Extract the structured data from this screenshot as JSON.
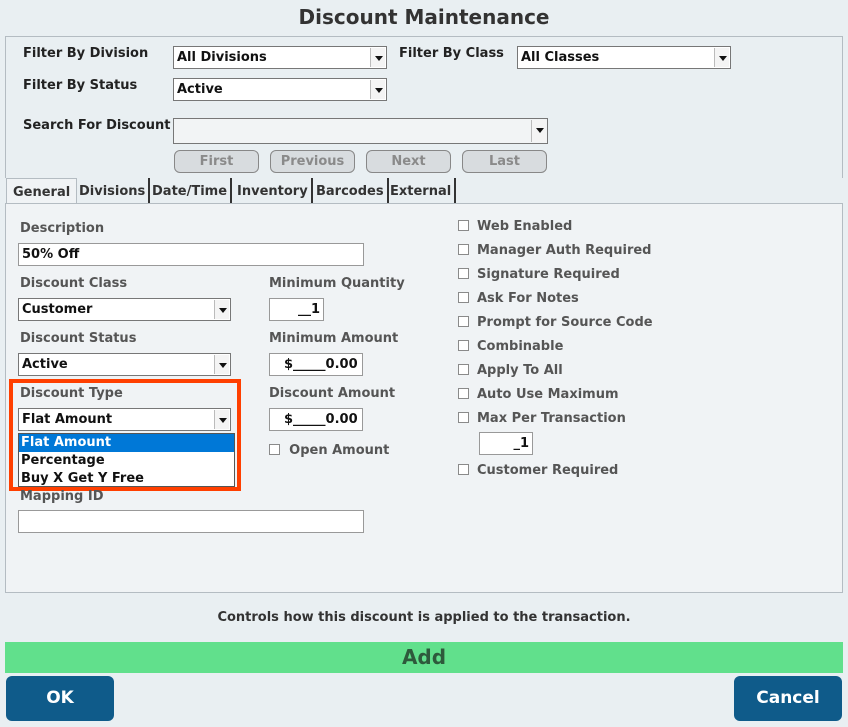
{
  "window": {
    "title": "Discount Maintenance"
  },
  "filters": {
    "division_label": "Filter By Division",
    "division_value": "All Divisions",
    "class_label": "Filter By Class",
    "class_value": "All Classes",
    "status_label": "Filter By Status",
    "status_value": "Active",
    "search_label": "Search For Discount",
    "search_value": ""
  },
  "nav": {
    "first": "First",
    "previous": "Previous",
    "next": "Next",
    "last": "Last"
  },
  "tabs": [
    {
      "label": "General"
    },
    {
      "label": "Divisions"
    },
    {
      "label": "Date/Time"
    },
    {
      "label": "Inventory"
    },
    {
      "label": "Barcodes"
    },
    {
      "label": "External"
    }
  ],
  "general": {
    "description_label": "Description",
    "description_value": "50% Off",
    "class_label": "Discount Class",
    "class_value": "Customer",
    "status_label": "Discount Status",
    "status_value": "Active",
    "type_label": "Discount Type",
    "type_value": "Flat Amount",
    "type_options": [
      "Flat Amount",
      "Percentage",
      "Buy X Get Y Free"
    ],
    "mapping_label": "Mapping ID",
    "mapping_value": "",
    "min_qty_label": "Minimum Quantity",
    "min_qty_value": "__1",
    "min_amount_label": "Minimum Amount",
    "min_amount_value": "$_____0.00",
    "discount_amount_label": "Discount Amount",
    "discount_amount_value": "$_____0.00",
    "open_amount_label": "Open Amount",
    "max_per_txn_value": "_1"
  },
  "checkboxes": [
    {
      "label": "Web Enabled",
      "checked": false
    },
    {
      "label": "Manager Auth Required",
      "checked": false
    },
    {
      "label": "Signature Required",
      "checked": false
    },
    {
      "label": "Ask For Notes",
      "checked": false
    },
    {
      "label": "Prompt for Source Code",
      "checked": false
    },
    {
      "label": "Combinable",
      "checked": false
    },
    {
      "label": "Apply To All",
      "checked": false
    },
    {
      "label": "Auto Use Maximum",
      "checked": false
    },
    {
      "label": "Max Per Transaction",
      "checked": false
    },
    {
      "label": "Customer Required",
      "checked": false
    }
  ],
  "footer": {
    "hint": "Controls how this discount is applied to the transaction.",
    "add_label": "Add",
    "ok_label": "OK",
    "cancel_label": "Cancel"
  },
  "colors": {
    "highlight": "#ff3f00",
    "add_bar": "#61e08c",
    "primary_button": "#0f5b8a",
    "selected_option": "#0078d7"
  }
}
